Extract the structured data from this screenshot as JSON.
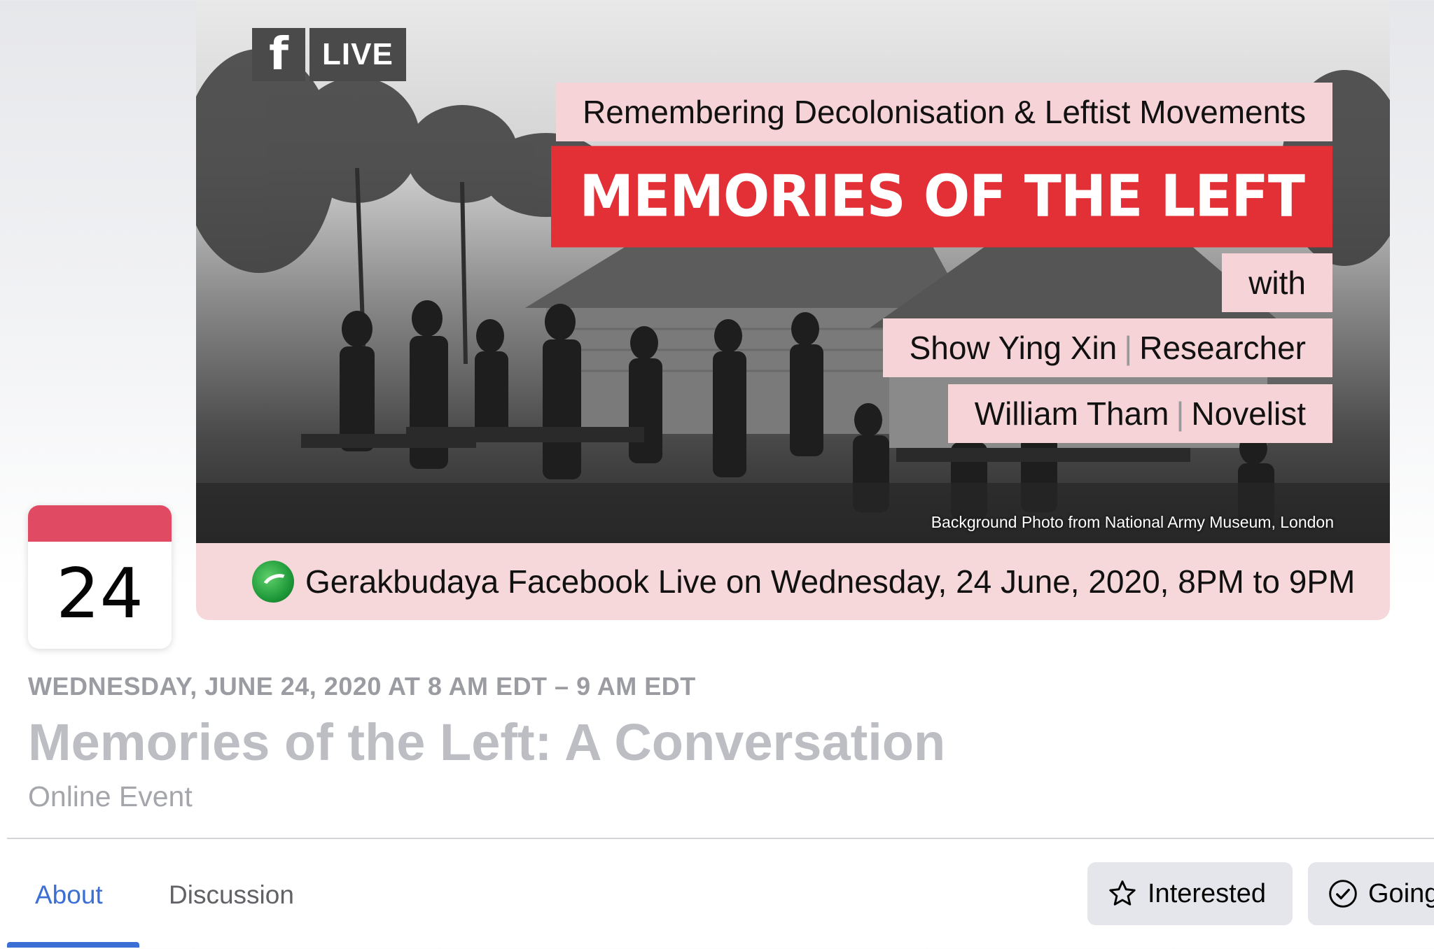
{
  "cover": {
    "fb_icon": "f",
    "live_label": "LIVE",
    "subtitle": "Remembering Decolonisation & Leftist Movements",
    "headline": "MEMORIES OF THE LEFT",
    "with_label": "with",
    "person1_name": "Show Ying Xin",
    "person1_role": "Researcher",
    "person2_name": "William Tham",
    "person2_role": "Novelist",
    "separator": "|",
    "photo_credit": "Background Photo from National Army Museum, London",
    "band_text": "Gerakbudaya Facebook Live on Wednesday, 24 June, 2020, 8PM to 9PM",
    "colors": {
      "headline_bg": "#e33036",
      "label_bg": "#f6d3d6"
    }
  },
  "calendar": {
    "day": "24",
    "accent": "#e04a63"
  },
  "event": {
    "date_line": "WEDNESDAY, JUNE 24, 2020 AT 8 AM EDT – 9 AM EDT",
    "title": "Memories of the Left: A Conversation",
    "location": "Online Event"
  },
  "tabs": [
    {
      "label": "About",
      "active": true
    },
    {
      "label": "Discussion",
      "active": false
    }
  ],
  "actions": {
    "interested_label": "Interested",
    "interested_icon": "star-icon",
    "going_label": "Going",
    "going_icon": "check-circle-icon"
  }
}
